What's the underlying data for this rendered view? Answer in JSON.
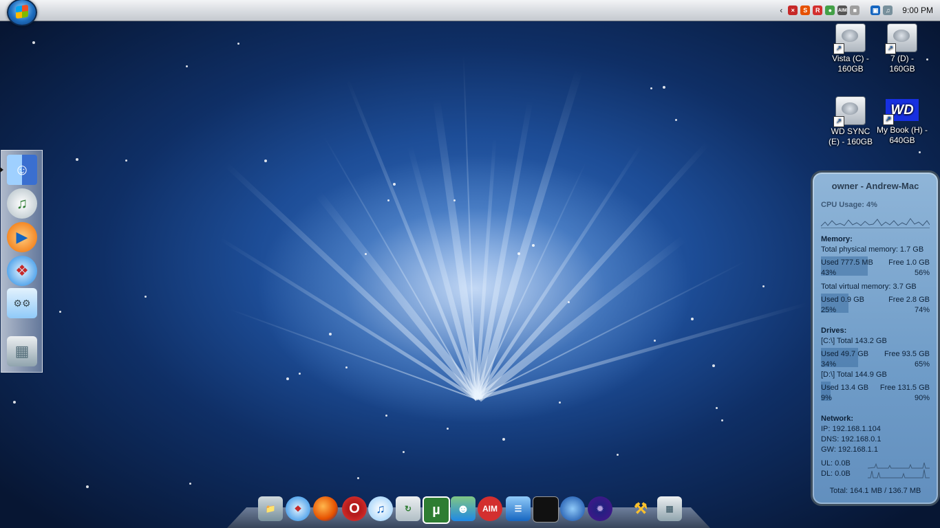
{
  "taskbar": {
    "clock": "9:00 PM",
    "tray_icons": [
      "chevron-left-icon",
      "security-icon",
      "app-s-icon",
      "app-r-icon",
      "messenger-icon",
      "aim-tray-icon",
      "network-tray-icon",
      "display-icon",
      "volume-icon"
    ]
  },
  "desktop_icons": [
    {
      "label": "Vista (C) - 160GB",
      "icon": "hard-drive-icon"
    },
    {
      "label": "7 (D) - 160GB",
      "icon": "hard-drive-icon"
    },
    {
      "label": "WD SYNC (E) - 160GB",
      "icon": "hard-drive-icon"
    },
    {
      "label": "My Book (H) - 640GB",
      "icon": "wd-drive-icon",
      "logo_text": "WD"
    }
  ],
  "side_dock": [
    "finder-icon",
    "itunes-icon",
    "media-player-icon",
    "safari-icon",
    "system-prefs-icon",
    "trash-icon"
  ],
  "gadget": {
    "title": "owner - Andrew-Mac",
    "cpu": "CPU Usage: 4%",
    "memory_header": "Memory:",
    "total_physical": "Total physical memory: 1.7 GB",
    "phys_used": "Used 777.5 MB",
    "phys_free": "Free 1.0 GB",
    "phys_used_pct": "43%",
    "phys_free_pct": "56%",
    "phys_used_frac": 0.43,
    "total_virtual": "Total virtual memory: 3.7 GB",
    "virt_used": "Used 0.9 GB",
    "virt_free": "Free 2.8 GB",
    "virt_used_pct": "25%",
    "virt_free_pct": "74%",
    "virt_used_frac": 0.25,
    "drives_header": "Drives:",
    "c_total": "[C:\\] Total 143.2 GB",
    "c_used": "Used 49.7 GB",
    "c_free": "Free 93.5 GB",
    "c_used_pct": "34%",
    "c_free_pct": "65%",
    "c_used_frac": 0.34,
    "d_total": "[D:\\] Total 144.9 GB",
    "d_used": "Used 13.4 GB",
    "d_free": "Free 131.5 GB",
    "d_used_pct": "9%",
    "d_free_pct": "90%",
    "d_used_frac": 0.09,
    "network_header": "Network:",
    "ip": "IP:   192.168.1.104",
    "dns": "DNS: 192.168.0.1",
    "gw": "GW:  192.168.1.1",
    "ul": "UL: 0.0B",
    "dl": "DL: 0.0B",
    "total": "Total: 164.1 MB / 136.7 MB"
  },
  "dock": [
    {
      "icon": "folder-icon",
      "text": ""
    },
    {
      "icon": "safari-icon",
      "text": ""
    },
    {
      "icon": "firefox-icon",
      "text": ""
    },
    {
      "icon": "opera-icon",
      "text": ""
    },
    {
      "icon": "itunes-icon",
      "text": ""
    },
    {
      "icon": "ipod-sync-icon",
      "text": ""
    },
    {
      "icon": "utorrent-icon",
      "text": "µ"
    },
    {
      "icon": "messenger-icon",
      "text": ""
    },
    {
      "icon": "aim-icon",
      "text": "AIM"
    },
    {
      "icon": "documents-icon",
      "text": ""
    },
    {
      "icon": "terminal-icon",
      "text": ""
    },
    {
      "icon": "google-earth-icon",
      "text": ""
    },
    {
      "icon": "fractal-icon",
      "text": ""
    },
    {
      "icon": "tools-icon",
      "text": ""
    },
    {
      "icon": "trash-icon",
      "text": ""
    }
  ]
}
